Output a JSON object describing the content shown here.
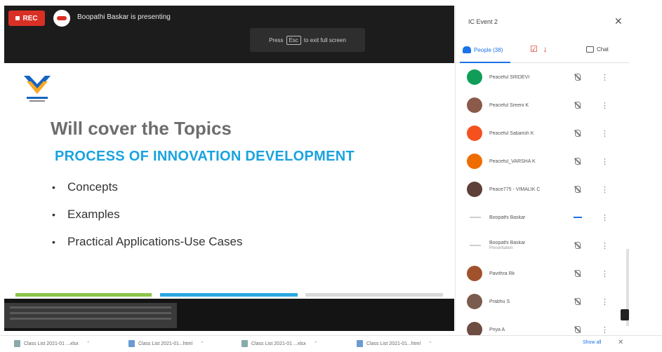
{
  "meeting": {
    "rec_label": "REC",
    "presenting_text": "Boopathi Baskar is presenting",
    "fullscreen_hint_pre": "Press",
    "fullscreen_hint_key": "Esc",
    "fullscreen_hint_post": "to exit full screen"
  },
  "slide": {
    "title": "Will cover the Topics",
    "subtitle": "PROCESS OF INNOVATION DEVELOPMENT",
    "bullets": [
      "Concepts",
      "Examples",
      "Practical Applications-Use Cases"
    ],
    "bar_colors": [
      "#8bc34a",
      "#29a8e0",
      "#d9d9d9"
    ]
  },
  "panel": {
    "title": "IC Event 2",
    "tab_people": "People (38)",
    "tab_chat": "Chat",
    "participants": [
      {
        "name": "Peaceful SRIDEVI",
        "avatar_color": "#0f9d58",
        "role": ""
      },
      {
        "name": "Peaceful Sreeni K",
        "avatar_color": "#8a5a4a",
        "role": ""
      },
      {
        "name": "Peaceful Sabarish K",
        "avatar_color": "#f4511e",
        "role": ""
      },
      {
        "name": "Peaceful_VARSHA K",
        "avatar_color": "#ef6c00",
        "role": ""
      },
      {
        "name": "Peace775 - VIMALIK C",
        "avatar_color": "#5d4037",
        "role": ""
      },
      {
        "name": "Boopathi Baskar",
        "avatar_color": "line",
        "role": ""
      },
      {
        "name": "Boopathi Baskar",
        "avatar_color": "line",
        "role": "Presentation"
      },
      {
        "name": "Pavithra Rk",
        "avatar_color": "#a0522d",
        "role": ""
      },
      {
        "name": "Prabhu S",
        "avatar_color": "#7a5c4e",
        "role": ""
      },
      {
        "name": "Priya A",
        "avatar_color": "#6d4c41",
        "role": ""
      }
    ]
  },
  "downloads": {
    "items": [
      "Class List 2021-01 ...xlsx",
      "Class List 2021-01...html",
      "Class List 2021-01 ...xlsx",
      "Class List 2021-01...html"
    ],
    "show_all": "Show all"
  },
  "colors": {
    "rec": "#d93025",
    "accent": "#1a73e8",
    "slide_title": "#6d6d6d",
    "slide_subtitle": "#1aa3df"
  }
}
